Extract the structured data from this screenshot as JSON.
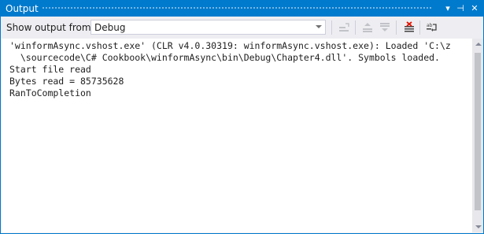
{
  "window": {
    "title": "Output",
    "menu_glyph": "▾",
    "pin_glyph": "⊣",
    "close_glyph": "✕"
  },
  "toolbar": {
    "show_output_label": "Show output from:",
    "source_selected": "Debug",
    "icons": [
      "find-message-in-code-icon",
      "go-to-previous-message-icon",
      "go-to-next-message-icon",
      "clear-all-icon",
      "toggle-word-wrap-icon"
    ]
  },
  "output": {
    "lines": [
      "'winformAsync.vshost.exe' (CLR v4.0.30319: winformAsync.vshost.exe): Loaded 'C:\\z",
      "  \\sourcecode\\C# Cookbook\\winformAsync\\bin\\Debug\\Chapter4.dll'. Symbols loaded.",
      "Start file read",
      "Bytes read = 85735628",
      "RanToCompletion"
    ]
  },
  "colors": {
    "accent": "#007acc",
    "panel_bg": "#eeeef2",
    "content_bg": "#ffffff",
    "clear_icon_red": "#e51400"
  }
}
